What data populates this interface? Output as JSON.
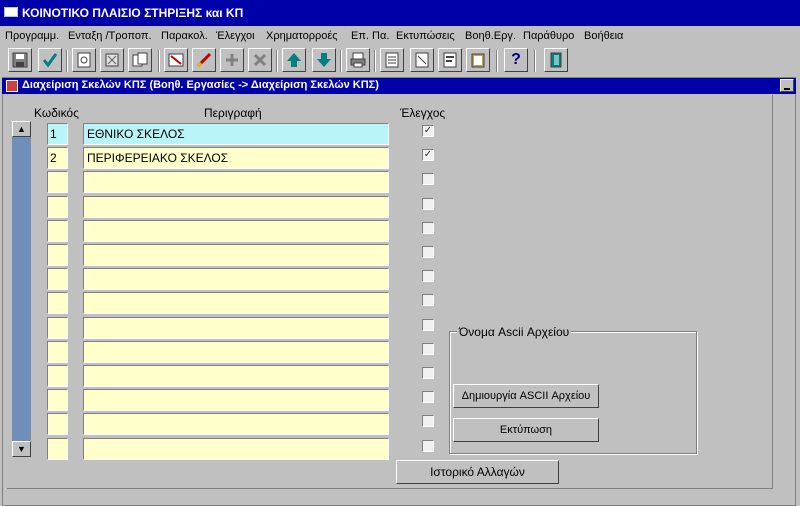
{
  "app": {
    "title": "ΚΟΙΝΟΤΙΚΟ ΠΛΑΙΣΙΟ ΣΤΗΡΙΞΗΣ και ΚΠ"
  },
  "menu": [
    "Προγραμμ.",
    "Ενταξη /Τροποπ.",
    "Παρακολ.",
    "Έλεγχοι",
    "Χρηματορροές",
    "Επ. Πα.",
    "Εκτυπώσεις",
    "Βοηθ.Εργ.",
    "Παράθυρο",
    "Βοήθεια"
  ],
  "toolbar": {
    "icons": [
      "save-icon",
      "check-icon",
      "query-icon",
      "clear-icon",
      "copy-icon",
      "delete-record-icon",
      "edit-icon",
      "add-record-icon",
      "remove-record-icon",
      "arrow-up-icon",
      "arrow-down-icon",
      "print-icon",
      "list-icon",
      "document-icon",
      "report-icon",
      "clipboard-icon",
      "help-icon",
      "exit-icon"
    ],
    "help_glyph": "?"
  },
  "window": {
    "title": "Διαχείριση Σκελών ΚΠΣ (Βοηθ. Εργασίες -> Διαχείριση Σκελών ΚΠΣ)"
  },
  "table": {
    "headers": {
      "code": "Κωδικός",
      "description": "Περιγραφή",
      "check": "Έλεγχος"
    },
    "rows": [
      {
        "code": "1",
        "description": "ΕΘΝΙΚΟ ΣΚΕΛΟΣ",
        "checked": true
      },
      {
        "code": "2",
        "description": "ΠΕΡΙΦΕΡΕΙΑΚΟ ΣΚΕΛΟΣ",
        "checked": true
      },
      {
        "code": "",
        "description": "",
        "checked": false
      },
      {
        "code": "",
        "description": "",
        "checked": false
      },
      {
        "code": "",
        "description": "",
        "checked": false
      },
      {
        "code": "",
        "description": "",
        "checked": false
      },
      {
        "code": "",
        "description": "",
        "checked": false
      },
      {
        "code": "",
        "description": "",
        "checked": false
      },
      {
        "code": "",
        "description": "",
        "checked": false
      },
      {
        "code": "",
        "description": "",
        "checked": false
      },
      {
        "code": "",
        "description": "",
        "checked": false
      },
      {
        "code": "",
        "description": "",
        "checked": false
      },
      {
        "code": "",
        "description": "",
        "checked": false
      },
      {
        "code": "",
        "description": "",
        "checked": false
      }
    ]
  },
  "ascii_group": {
    "label": "Όνομα Ascii Αρχείου",
    "create_button": "Δημιουργία  ASCII Αρχείου",
    "print_button": "Εκτύπωση"
  },
  "history_button": "Ιστορικό Αλλαγών",
  "colors": {
    "title_bg": "#0000a8",
    "field_bg": "#ffffcc",
    "active_field_bg": "#b8f4f8",
    "scrollbar": "#6f8fb8"
  }
}
